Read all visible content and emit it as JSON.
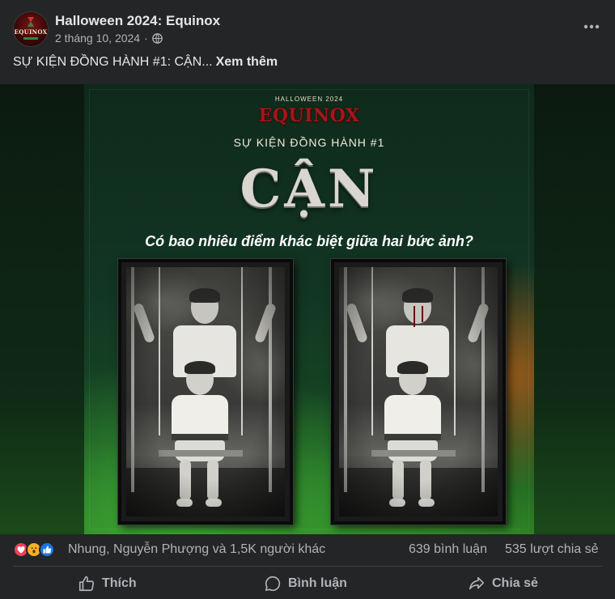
{
  "post": {
    "page_name": "Halloween 2024: Equinox",
    "date": "2 tháng 10, 2024",
    "separator": "·",
    "text": "SỰ KIỆN ĐỒNG HÀNH #1: CẬN...",
    "see_more": "Xem thêm",
    "avatar_logo_text": "EQUINOX"
  },
  "poster": {
    "top_line": "HALLOWEEN 2024",
    "logo": "EQUINOX",
    "event_line": "SỰ KIỆN ĐỒNG HÀNH #1",
    "title": "CẬN",
    "question": "Có bao nhiêu điểm khác biệt giữa hai bức ảnh?"
  },
  "stats": {
    "reactions_summary": "Nhung, Nguyễn Phượng và 1,5K người khác",
    "comments": "639 bình luận",
    "shares": "535 lượt chia sẻ"
  },
  "actions": {
    "like": "Thích",
    "comment": "Bình luận",
    "share": "Chia sẻ"
  },
  "colors": {
    "background": "#242526",
    "text_primary": "#e4e6eb",
    "text_secondary": "#b0b3b8",
    "love": "#f33e58",
    "wow": "#f7b125",
    "like": "#1b74e4"
  }
}
